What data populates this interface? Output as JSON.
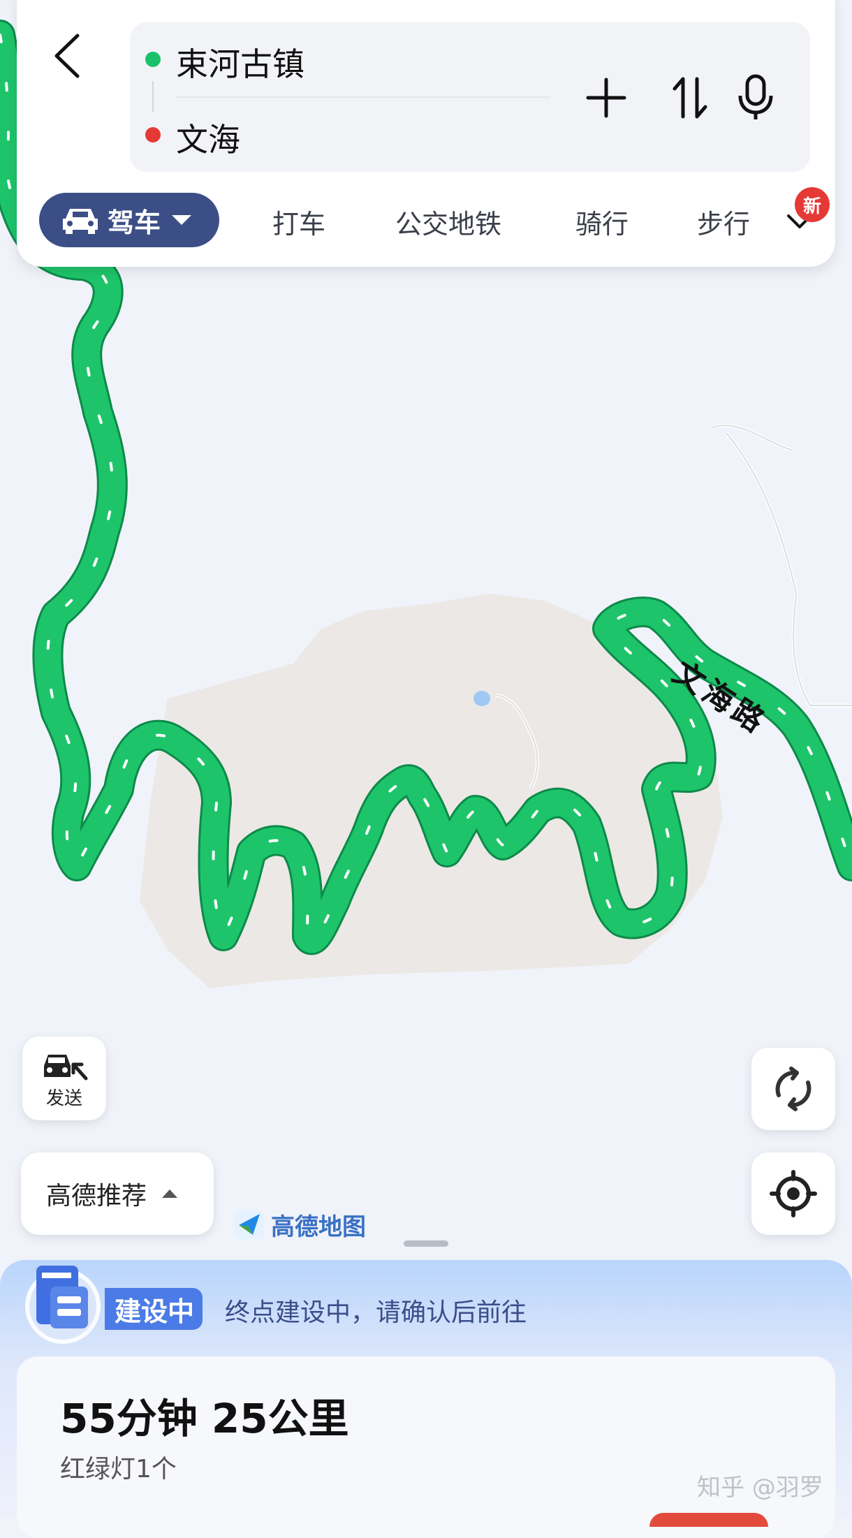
{
  "header": {
    "start_location": "束河古镇",
    "end_location": "文海"
  },
  "modes": {
    "drive": "驾车",
    "taxi": "打车",
    "transit": "公交地铁",
    "bike": "骑行",
    "walk": "步行",
    "new_badge": "新"
  },
  "map": {
    "road_label": "文海路",
    "send_label": "发送",
    "recommend_label": "高德推荐",
    "brand": "高德地图",
    "route_color": "#1ec46a",
    "area_color": "#ece8e5"
  },
  "sheet": {
    "status_badge": "建设中",
    "status_text": "终点建设中，请确认后前往",
    "eta": "55分钟  25公里",
    "traffic_lights": "红绿灯1个"
  },
  "watermark": "知乎 @羽罗"
}
